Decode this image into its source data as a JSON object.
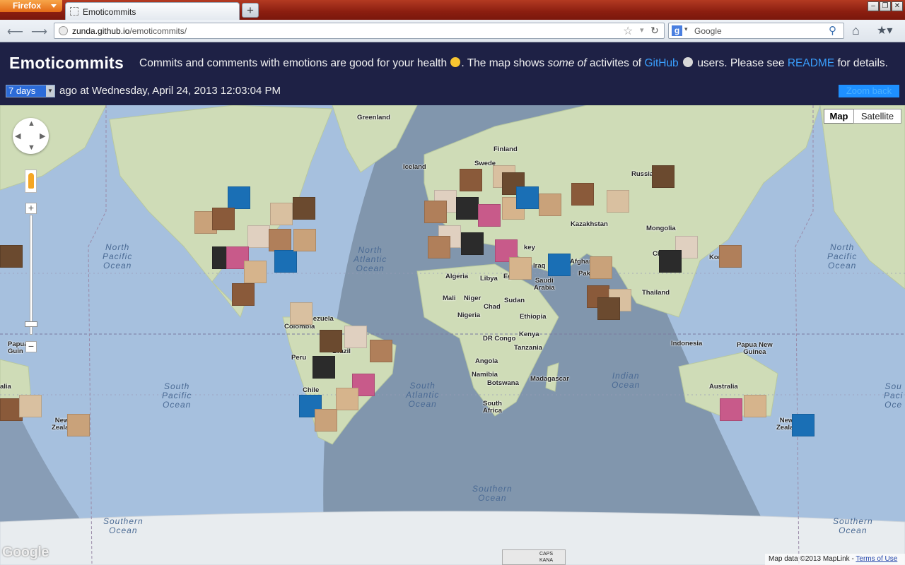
{
  "browser": {
    "menu_label": "Firefox",
    "tab_title": "Emoticommits",
    "new_tab": "+",
    "url_host": "zunda.github.io",
    "url_path": "/emoticommits/",
    "search_engine_label": "g",
    "search_placeholder": "Google"
  },
  "header": {
    "title": "Emoticommits",
    "tagline_part1": "Commits and comments with emotions are good for your health",
    "tagline_part2": ". The map shows",
    "tagline_em": "some of",
    "tagline_part3": "activites of",
    "github_link": "GitHub",
    "tagline_part4": "users. Please see",
    "readme_link": "README",
    "tagline_part5": "for details.",
    "range_value": "7 days",
    "time_text": "ago at Wednesday, April 24, 2013 12:03:04 PM",
    "zoom_back": "Zoom back"
  },
  "map": {
    "type_map": "Map",
    "type_satellite": "Satellite",
    "google_logo": "Google",
    "attribution": "Map data ©2013 MapLink -",
    "terms": "Terms of Use",
    "ime_caps": "CAPS",
    "ime_kana": "KANA",
    "labels": {
      "greenland": "Greenland",
      "iceland": "Iceland",
      "finland": "Finland",
      "sweden": "Swede",
      "russia": "Russia",
      "kazakhstan": "Kazakhstan",
      "mongolia": "Mongolia",
      "china": "Ch",
      "korea": "Kor",
      "algeria": "Algeria",
      "libya": "Libya",
      "egypt": "Eg",
      "iraq": "Iraq",
      "saudi": "Saudi\nArabia",
      "afghan": "Afghan",
      "pak": "Paki",
      "key": "key",
      "mali": "Mali",
      "niger": "Niger",
      "chad": "Chad",
      "sudan": "Sudan",
      "nigeria": "Nigeria",
      "ethiopia": "Ethiopia",
      "kenya": "Kenya",
      "drcongo": "DR Congo",
      "tanzania": "Tanzania",
      "angola": "Angola",
      "namibia": "Namibia",
      "botswana": "Botswana",
      "madagascar": "Madagascar",
      "southafrica": "South\nAfrica",
      "thailand": "Thailand",
      "indonesia": "Indonesia",
      "png": "Papua New\nGuinea",
      "australia": "Australia",
      "australia_left": "alia",
      "nz": "New\nZeala",
      "nz_left": "Papua\nGuin",
      "colombia": "Colombia",
      "venezuela": "nezuela",
      "peru": "Peru",
      "brazil": "Brazil",
      "chile": "Chile",
      "nz_right": "New\nZeala"
    },
    "oceans": {
      "north_pacific_left": "North\nPacific\nOcean",
      "north_pacific_right": "North\nPacific\nOcean",
      "north_atlantic": "North\nAtlantic\nOcean",
      "south_pacific": "South\nPacific\nOcean",
      "south_atlantic": "South\nAtlantic\nOcean",
      "indian": "Indian\nOcean",
      "southern_center": "Southern\nOcean",
      "southern_left": "Southern\nOcean",
      "southern_right": "Southern\nOcean",
      "south_right_edge": "Sou\nPaci\nOce"
    },
    "avatar_colors": [
      "#1a6fb5",
      "#c9a27a",
      "#8a5a3a",
      "#d9c0a0",
      "#6b4a2f",
      "#e0d0c0",
      "#b07f5a",
      "#2b2b2b",
      "#c85a8a",
      "#d6b48c"
    ]
  }
}
